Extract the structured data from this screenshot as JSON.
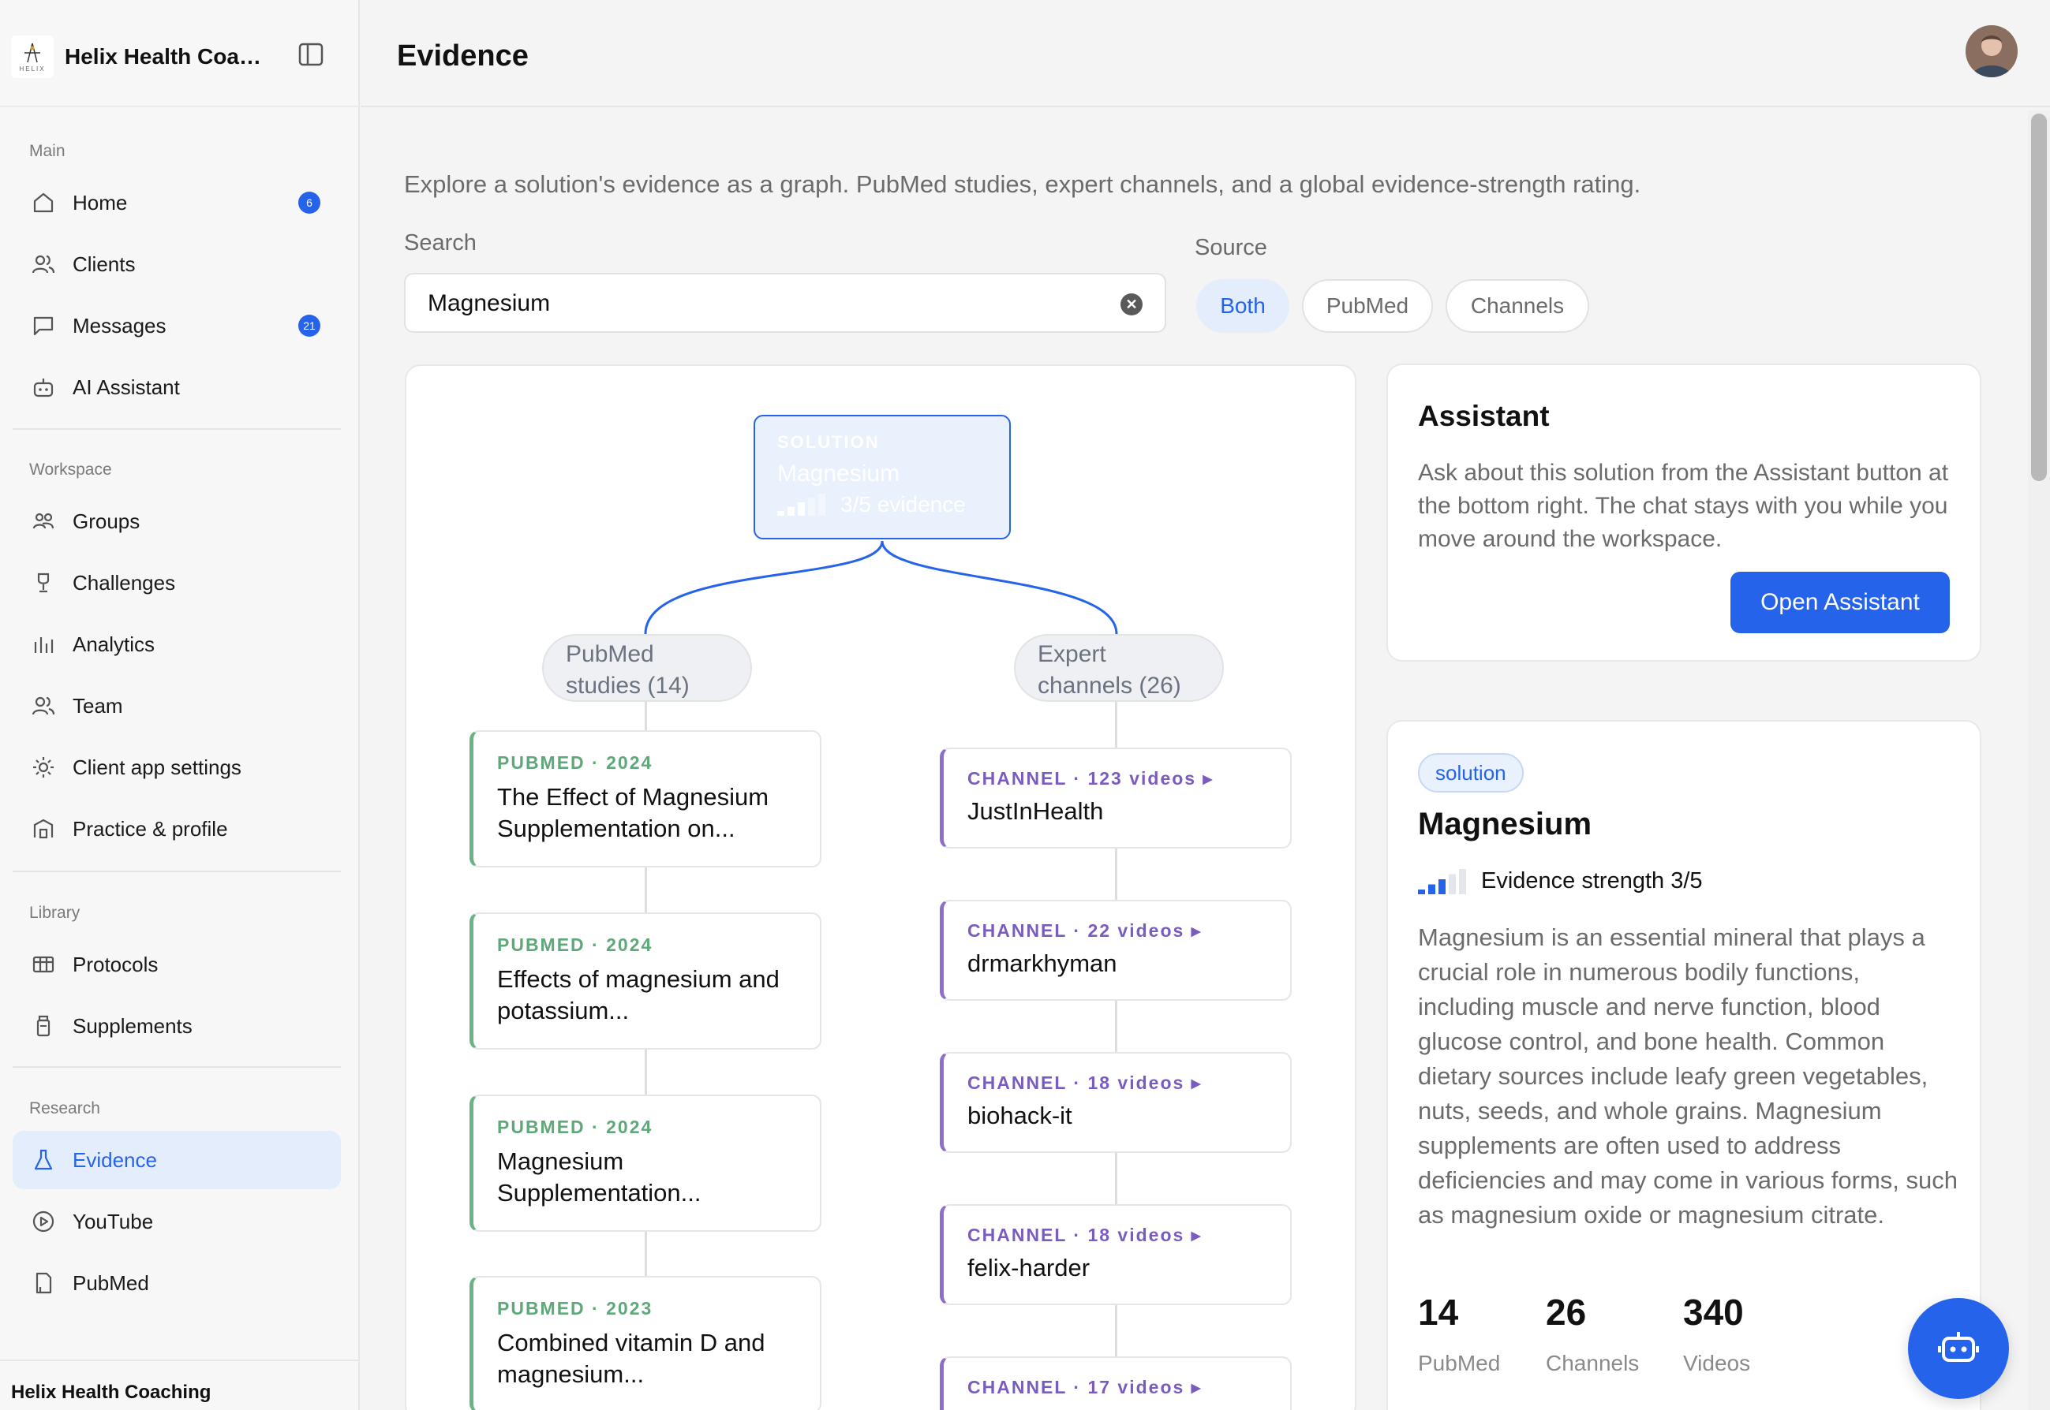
{
  "app": {
    "name": "Helix Health Coac...",
    "footer": "Helix Health Coaching"
  },
  "sidebar": {
    "sections": [
      {
        "label": "Main"
      },
      {
        "label": "Workspace"
      },
      {
        "label": "Library"
      },
      {
        "label": "Research"
      }
    ],
    "items": [
      {
        "label": "Home",
        "icon": "home-icon",
        "badge": "6"
      },
      {
        "label": "Clients",
        "icon": "users-icon"
      },
      {
        "label": "Messages",
        "icon": "message-icon",
        "badge": "21"
      },
      {
        "label": "AI Assistant",
        "icon": "robot-icon"
      },
      {
        "label": "Groups",
        "icon": "group-icon"
      },
      {
        "label": "Challenges",
        "icon": "trophy-icon"
      },
      {
        "label": "Analytics",
        "icon": "bar-chart-icon"
      },
      {
        "label": "Team",
        "icon": "team-icon"
      },
      {
        "label": "Client app settings",
        "icon": "settings-icon"
      },
      {
        "label": "Practice & profile",
        "icon": "building-icon"
      },
      {
        "label": "Protocols",
        "icon": "columns-icon"
      },
      {
        "label": "Supplements",
        "icon": "bottle-icon"
      },
      {
        "label": "Evidence",
        "icon": "flask-icon",
        "active": true
      },
      {
        "label": "YouTube",
        "icon": "play-icon"
      },
      {
        "label": "PubMed",
        "icon": "document-icon"
      }
    ]
  },
  "header": {
    "title": "Evidence"
  },
  "main": {
    "intro": "Explore a solution's evidence as a graph. PubMed studies, expert channels, and a global evidence-strength rating.",
    "search": {
      "label": "Search",
      "value": "Magnesium"
    },
    "source": {
      "label": "Source",
      "options": [
        "Both",
        "PubMed",
        "Channels"
      ],
      "selected": "Both"
    }
  },
  "graph": {
    "solution": {
      "kicker": "SOLUTION",
      "title": "Magnesium",
      "strength": "3/5 evidence",
      "strength_level": 3
    },
    "groups": {
      "pubmed": "PubMed studies (14)",
      "channels": "Expert channels (26)"
    },
    "pubmed": [
      {
        "meta": "PUBMED · 2024",
        "title": "The Effect of Magnesium Supplementation on..."
      },
      {
        "meta": "PUBMED · 2024",
        "title": "Effects of magnesium and potassium..."
      },
      {
        "meta": "PUBMED · 2024",
        "title": "Magnesium Supplementation..."
      },
      {
        "meta": "PUBMED · 2023",
        "title": "Combined vitamin D and magnesium..."
      }
    ],
    "channels": [
      {
        "meta": "CHANNEL · 123 videos ▸",
        "name": "JustInHealth"
      },
      {
        "meta": "CHANNEL · 22 videos ▸",
        "name": "drmarkhyman"
      },
      {
        "meta": "CHANNEL · 18 videos ▸",
        "name": "biohack-it"
      },
      {
        "meta": "CHANNEL · 18 videos ▸",
        "name": "felix-harder"
      },
      {
        "meta": "CHANNEL · 17 videos ▸",
        "name": ""
      }
    ]
  },
  "assistant": {
    "title": "Assistant",
    "body": "Ask about this solution from the Assistant button at the bottom right. The chat stays with you while you move around the workspace.",
    "button": "Open Assistant"
  },
  "solution_card": {
    "tag": "solution",
    "title": "Magnesium",
    "strength": "Evidence strength 3/5",
    "strength_level": 3,
    "description": "Magnesium is an essential mineral that plays a crucial role in numerous bodily functions, including muscle and nerve function, blood glucose control, and bone health. Common dietary sources include leafy green vegetables, nuts, seeds, and whole grains. Magnesium supplements are often used to address deficiencies and may come in various forms, such as magnesium oxide or magnesium citrate.",
    "stats": [
      {
        "value": "14",
        "label": "PubMed"
      },
      {
        "value": "26",
        "label": "Channels"
      },
      {
        "value": "340",
        "label": "Videos"
      }
    ]
  },
  "colors": {
    "accent": "#2563eb",
    "pubmed": "#5fa87a",
    "channel": "#7a5cc0"
  }
}
